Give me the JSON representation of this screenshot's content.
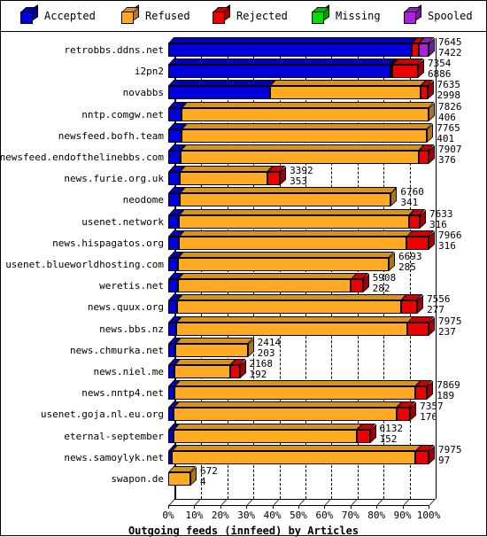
{
  "legend": {
    "items": [
      {
        "label": "Accepted",
        "color": "#0000dd",
        "icon": "cube-icon"
      },
      {
        "label": "Refused",
        "color": "#ffaa22",
        "icon": "cube-icon"
      },
      {
        "label": "Rejected",
        "color": "#ee0000",
        "icon": "cube-icon"
      },
      {
        "label": "Missing",
        "color": "#00dd00",
        "icon": "cube-icon"
      },
      {
        "label": "Spooled",
        "color": "#aa22dd",
        "icon": "cube-icon"
      }
    ]
  },
  "chart_data": {
    "type": "bar",
    "orientation": "horizontal",
    "stacked": true,
    "normalized": true,
    "title": "Outgoing feeds (innfeed) by Articles",
    "xlabel": "Outgoing feeds (innfeed) by Articles",
    "ylabel": "",
    "xlim": [
      0,
      100
    ],
    "xticklabels": [
      "0%",
      "10%",
      "20%",
      "30%",
      "40%",
      "50%",
      "60%",
      "70%",
      "80%",
      "90%",
      "100%"
    ],
    "xtickvalues": [
      0,
      10,
      20,
      30,
      40,
      50,
      60,
      70,
      80,
      90,
      100
    ],
    "grid": true,
    "legend_position": "top",
    "series": [
      {
        "name": "Accepted",
        "color": "#0000dd"
      },
      {
        "name": "Refused",
        "color": "#ffaa22"
      },
      {
        "name": "Rejected",
        "color": "#ee0000"
      },
      {
        "name": "Missing",
        "color": "#00dd00"
      },
      {
        "name": "Spooled",
        "color": "#aa22dd"
      }
    ],
    "categories": [
      "retrobbs.ddns.net",
      "i2pn2",
      "novabbs",
      "nntp.comgw.net",
      "newsfeed.bofh.team",
      "newsfeed.endofthelinebbs.com",
      "news.furie.org.uk",
      "neodome",
      "usenet.network",
      "news.hispagatos.org",
      "usenet.blueworldhosting.com",
      "weretis.net",
      "news.quux.org",
      "news.bbs.nz",
      "news.chmurka.net",
      "news.niel.me",
      "news.nntp4.net",
      "usenet.goja.nl.eu.org",
      "eternal-september",
      "news.samoylyk.net",
      "swapon.de"
    ],
    "rows": [
      {
        "category": "retrobbs.ddns.net",
        "top_value": "7645",
        "bottom_value": "7422",
        "total_pct": 100.0,
        "segments": [
          {
            "name": "Accepted",
            "pct": 93.5
          },
          {
            "name": "Rejected",
            "pct": 2.6
          },
          {
            "name": "Spooled",
            "pct": 3.9
          }
        ]
      },
      {
        "category": "i2pn2",
        "top_value": "7354",
        "bottom_value": "6886",
        "total_pct": 95.9,
        "segments": [
          {
            "name": "Accepted",
            "pct": 85.3
          },
          {
            "name": "Refused",
            "pct": 0.7
          },
          {
            "name": "Rejected",
            "pct": 9.9
          }
        ]
      },
      {
        "category": "novabbs",
        "top_value": "7635",
        "bottom_value": "2998",
        "total_pct": 99.5,
        "segments": [
          {
            "name": "Accepted",
            "pct": 39.2
          },
          {
            "name": "Refused",
            "pct": 57.7
          },
          {
            "name": "Rejected",
            "pct": 2.6
          }
        ]
      },
      {
        "category": "nntp.comgw.net",
        "top_value": "7826",
        "bottom_value": "406",
        "total_pct": 100.0,
        "segments": [
          {
            "name": "Accepted",
            "pct": 5.2
          },
          {
            "name": "Refused",
            "pct": 94.8
          }
        ]
      },
      {
        "category": "newsfeed.bofh.team",
        "top_value": "7765",
        "bottom_value": "401",
        "total_pct": 99.4,
        "segments": [
          {
            "name": "Accepted",
            "pct": 5.2
          },
          {
            "name": "Refused",
            "pct": 94.2
          }
        ]
      },
      {
        "category": "newsfeed.endofthelinebbs.com",
        "top_value": "7907",
        "bottom_value": "376",
        "total_pct": 100.0,
        "segments": [
          {
            "name": "Accepted",
            "pct": 4.8
          },
          {
            "name": "Refused",
            "pct": 91.6
          },
          {
            "name": "Rejected",
            "pct": 3.6
          }
        ]
      },
      {
        "category": "news.furie.org.uk",
        "top_value": "3392",
        "bottom_value": "353",
        "total_pct": 42.9,
        "segments": [
          {
            "name": "Accepted",
            "pct": 4.5
          },
          {
            "name": "Refused",
            "pct": 33.7
          },
          {
            "name": "Rejected",
            "pct": 4.7
          }
        ]
      },
      {
        "category": "neodome",
        "top_value": "6760",
        "bottom_value": "341",
        "total_pct": 85.5,
        "segments": [
          {
            "name": "Accepted",
            "pct": 4.3
          },
          {
            "name": "Refused",
            "pct": 81.2
          }
        ]
      },
      {
        "category": "usenet.network",
        "top_value": "7633",
        "bottom_value": "316",
        "total_pct": 96.6,
        "segments": [
          {
            "name": "Accepted",
            "pct": 4.0
          },
          {
            "name": "Refused",
            "pct": 88.4
          },
          {
            "name": "Rejected",
            "pct": 4.2
          }
        ]
      },
      {
        "category": "news.hispagatos.org",
        "top_value": "7966",
        "bottom_value": "316",
        "total_pct": 100.0,
        "segments": [
          {
            "name": "Accepted",
            "pct": 4.0
          },
          {
            "name": "Refused",
            "pct": 87.6
          },
          {
            "name": "Rejected",
            "pct": 8.4
          }
        ]
      },
      {
        "category": "usenet.blueworldhosting.com",
        "top_value": "6693",
        "bottom_value": "285",
        "total_pct": 84.7,
        "segments": [
          {
            "name": "Accepted",
            "pct": 3.6
          },
          {
            "name": "Refused",
            "pct": 81.1
          }
        ]
      },
      {
        "category": "weretis.net",
        "top_value": "5908",
        "bottom_value": "282",
        "total_pct": 74.7,
        "segments": [
          {
            "name": "Accepted",
            "pct": 3.6
          },
          {
            "name": "Refused",
            "pct": 66.5
          },
          {
            "name": "Rejected",
            "pct": 4.6
          }
        ]
      },
      {
        "category": "news.quux.org",
        "top_value": "7556",
        "bottom_value": "277",
        "total_pct": 95.6,
        "segments": [
          {
            "name": "Accepted",
            "pct": 3.5
          },
          {
            "name": "Refused",
            "pct": 86.0
          },
          {
            "name": "Rejected",
            "pct": 6.1
          }
        ]
      },
      {
        "category": "news.bbs.nz",
        "top_value": "7975",
        "bottom_value": "237",
        "total_pct": 100.0,
        "segments": [
          {
            "name": "Accepted",
            "pct": 3.0
          },
          {
            "name": "Refused",
            "pct": 89.0
          },
          {
            "name": "Rejected",
            "pct": 8.0
          }
        ]
      },
      {
        "category": "news.chmurka.net",
        "top_value": "2414",
        "bottom_value": "203",
        "total_pct": 30.5,
        "segments": [
          {
            "name": "Accepted",
            "pct": 2.6
          },
          {
            "name": "Refused",
            "pct": 27.9
          }
        ]
      },
      {
        "category": "news.niel.me",
        "top_value": "2168",
        "bottom_value": "192",
        "total_pct": 27.4,
        "segments": [
          {
            "name": "Accepted",
            "pct": 2.4
          },
          {
            "name": "Refused",
            "pct": 21.4
          },
          {
            "name": "Rejected",
            "pct": 3.6
          }
        ]
      },
      {
        "category": "news.nntp4.net",
        "top_value": "7869",
        "bottom_value": "189",
        "total_pct": 99.4,
        "segments": [
          {
            "name": "Accepted",
            "pct": 2.4
          },
          {
            "name": "Refused",
            "pct": 92.6
          },
          {
            "name": "Rejected",
            "pct": 4.4
          }
        ]
      },
      {
        "category": "usenet.goja.nl.eu.org",
        "top_value": "7357",
        "bottom_value": "176",
        "total_pct": 92.9,
        "segments": [
          {
            "name": "Accepted",
            "pct": 2.2
          },
          {
            "name": "Refused",
            "pct": 85.7
          },
          {
            "name": "Rejected",
            "pct": 5.0
          }
        ]
      },
      {
        "category": "eternal-september",
        "top_value": "6132",
        "bottom_value": "152",
        "total_pct": 77.4,
        "segments": [
          {
            "name": "Accepted",
            "pct": 1.9
          },
          {
            "name": "Refused",
            "pct": 70.5
          },
          {
            "name": "Rejected",
            "pct": 5.0
          }
        ]
      },
      {
        "category": "news.samoylyk.net",
        "top_value": "7975",
        "bottom_value": "97",
        "total_pct": 100.0,
        "segments": [
          {
            "name": "Accepted",
            "pct": 1.2
          },
          {
            "name": "Refused",
            "pct": 93.8
          },
          {
            "name": "Rejected",
            "pct": 5.0
          }
        ]
      },
      {
        "category": "swapon.de",
        "top_value": "672",
        "bottom_value": "4",
        "total_pct": 8.5,
        "segments": [
          {
            "name": "Refused",
            "pct": 8.5
          }
        ]
      }
    ]
  }
}
